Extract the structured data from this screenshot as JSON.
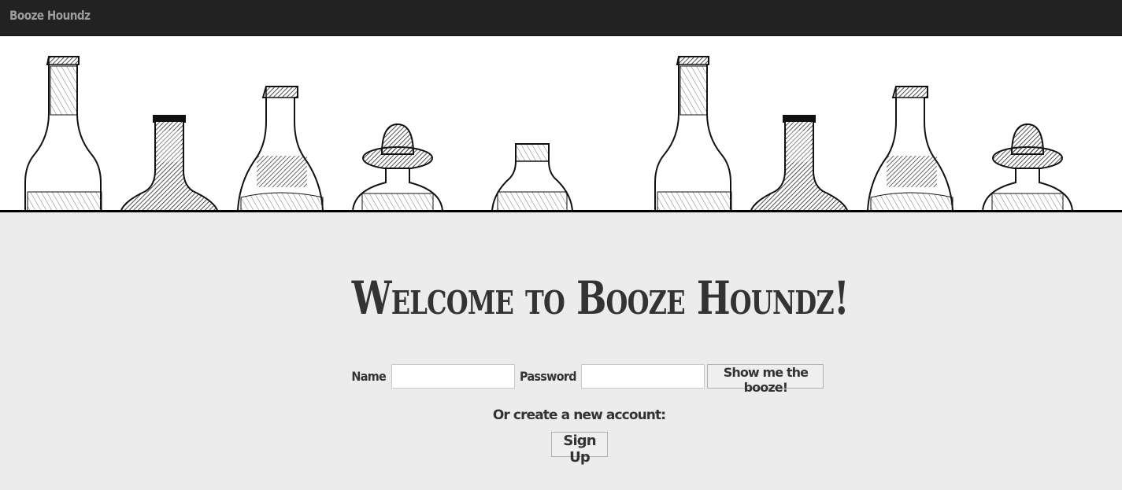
{
  "navbar": {
    "brand": "Booze Houndz"
  },
  "banner": {
    "image": "liquor-bottles-sketch-banner"
  },
  "main": {
    "welcome": "Welcome to Booze Houndz!",
    "login": {
      "name_label": "Name",
      "name_value": "",
      "password_label": "Password",
      "password_value": "",
      "submit_label": "Show me the booze!"
    },
    "signup": {
      "prompt": "Or create a new account:",
      "button_label": "Sign Up"
    }
  }
}
